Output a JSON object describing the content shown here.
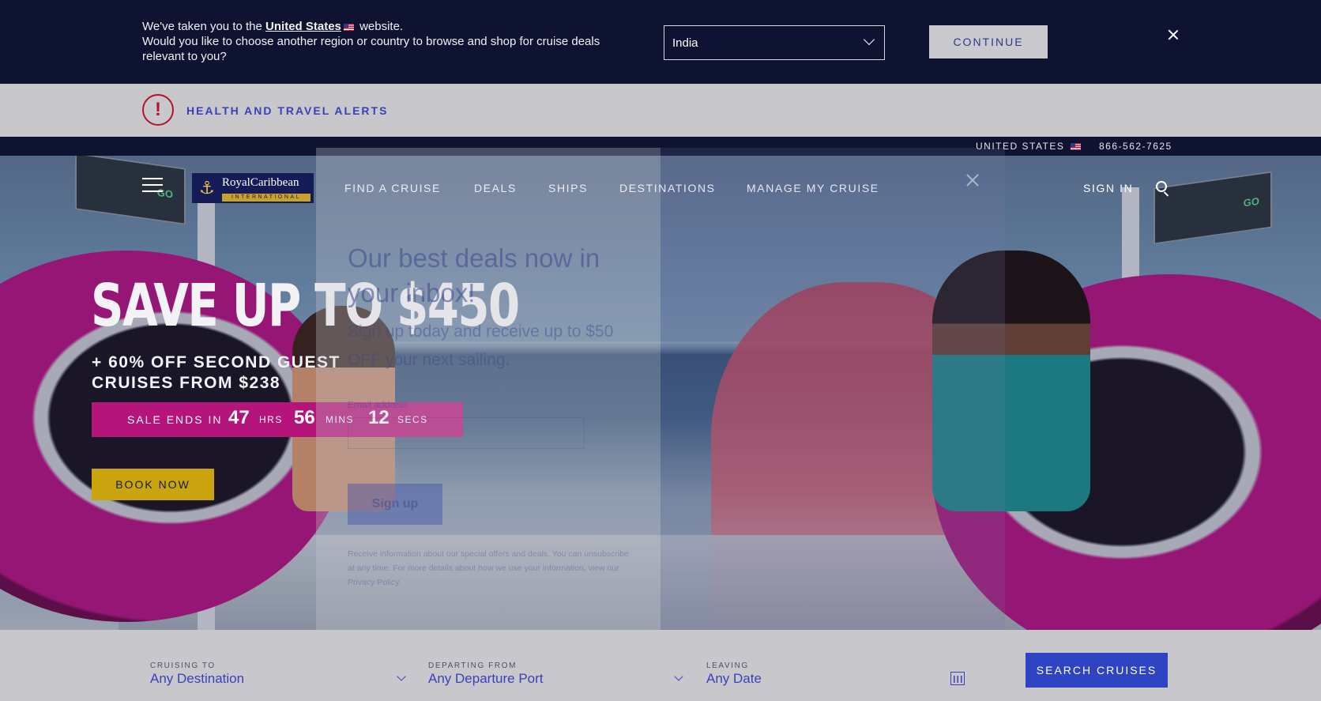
{
  "region_banner": {
    "line1_prefix": "We've taken you to the",
    "line1_country": "United States",
    "line1_suffix": "website.",
    "line2": "Would you like to choose another region or country to browse and shop for cruise deals relevant to you?",
    "selected_region": "India",
    "continue_label": "CONTINUE"
  },
  "alerts": {
    "label": "HEALTH AND TRAVEL ALERTS",
    "icon": "!"
  },
  "utility": {
    "country": "UNITED STATES",
    "phone": "866-562-7625"
  },
  "logo": {
    "name": "RoyalCaribbean",
    "sub": "INTERNATIONAL"
  },
  "nav": {
    "items": [
      {
        "label": "FIND A CRUISE"
      },
      {
        "label": "DEALS"
      },
      {
        "label": "SHIPS"
      },
      {
        "label": "DESTINATIONS"
      },
      {
        "label": "MANAGE MY CRUISE"
      }
    ],
    "sign_in": "SIGN IN"
  },
  "hero": {
    "headline": "SAVE UP TO $450",
    "sub_line1": "+ 60% OFF SECOND GUEST",
    "sub_line2": "CRUISES FROM $238",
    "sale_label": "SALE ENDS IN",
    "countdown": [
      {
        "value": "47",
        "unit": "HRS"
      },
      {
        "value": "56",
        "unit": "MINS"
      },
      {
        "value": "12",
        "unit": "SECS"
      }
    ],
    "cta": "BOOK NOW"
  },
  "signup_modal": {
    "title": "Our best deals now in your inbox!",
    "description": "Sign up today and receive up to $50 OFF your next sailing.",
    "email_label": "Email address",
    "button": "Sign up",
    "fine_print": "Receive information about our special offers and deals. You can unsubscribe at any time. For more details about how we use your information, view our Privacy Policy."
  },
  "search_bar": {
    "destination": {
      "label": "CRUISING TO",
      "value": "Any Destination"
    },
    "port": {
      "label": "DEPARTING FROM",
      "value": "Any Departure Port"
    },
    "date": {
      "label": "LEAVING",
      "value": "Any Date"
    },
    "button": "SEARCH CRUISES"
  },
  "colors": {
    "banner_bg": "#0d1330",
    "accent_blue": "#3a41b8",
    "sale_magenta": "#b5147a",
    "cta_gold": "#c9a40c",
    "alert_red": "#b5132a"
  }
}
